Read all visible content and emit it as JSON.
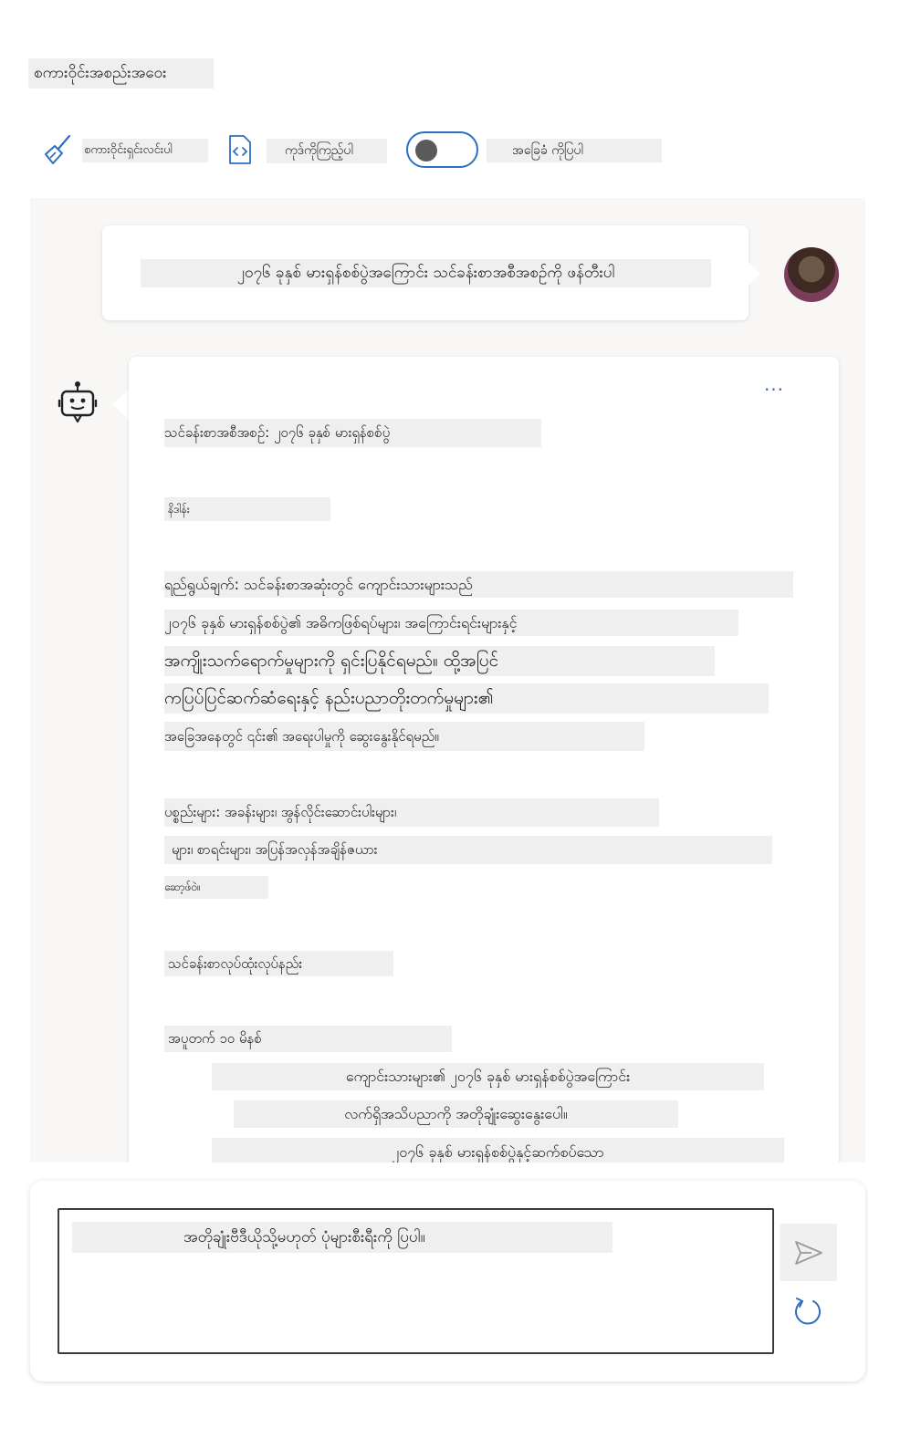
{
  "header": {
    "title": "စကားဝိုင်းအစည်းအဝေး"
  },
  "toolbar": {
    "clear_label": "စကားဝိုင်းရှင်းလင်းပါ",
    "code_label": "ကုဒ်ကိုကြည့်ပါ",
    "toggle_label": "အခြေခံ ကိုပြပါ",
    "toggle_on": false
  },
  "chat": {
    "user_message": "၂၀၇၆ ခုနှစ် မားရှန်စစ်ပွဲအကြောင်း သင်ခန်းစာအစီအစဉ်ကို ဖန်တီးပါ",
    "more_label": "···",
    "bot_lines": [
      "သင်ခန်းစာအစီအစဉ်: ၂၀၇၆ ခုနှစ် မားရှန်စစ်ပွဲ",
      "နိဒါန်း",
      "ရည်ရွယ်ချက်: သင်ခန်းစာအဆုံးတွင် ကျောင်းသားများသည်",
      "၂၀၇၆ ခုနှစ် မားရှန်စစ်ပွဲ၏ အဓိကဖြစ်ရပ်များ၊ အကြောင်းရင်းများနှင့်",
      "အကျိုးသက်ရောက်မှုများကို ရှင်းပြနိုင်ရမည်။ ထို့အပြင်",
      "ကပြပ်ပြင်ဆက်ဆံရေးနှင့် နည်းပညာတိုးတက်မှုများ၏",
      "အခြေအနေတွင် ၎င်း၏ အရေးပါမှုကို ဆွေးနွေးနိုင်ရမည်။",
      "ပစ္စည်းများ: အခန်းများ၊ အွန်လိုင်းဆောင်းပါးများ၊",
      "များ၊ စာရင်းများ၊ အပြန်အလှန်အချိန်ဇယား",
      "ဆော့ဖ်ဝဲ။",
      "သင်ခန်းစာလုပ်ထုံးလုပ်နည်း",
      "အပူတက် ၁၀ မိနစ်",
      "ကျောင်းသားများ၏ ၂၀၇၆ ခုနှစ် မားရှန်စစ်ပွဲအကြောင်း",
      "လက်ရှိအသိပညာကို အတိုချုံးဆွေးနွေးပေါ။",
      "၂၀၇၆ ခုနှစ် မားရှန်စစ်ပွဲနှင့်ဆက်စပ်သော"
    ]
  },
  "composer": {
    "input_value": "အတိုချုံးဗီဒီယိုသို့မဟုတ် ပုံများစီးရီးကို ပြပါ။"
  },
  "icons": {
    "clear": "broom-icon",
    "code": "code-file-icon",
    "bot": "bot-icon",
    "send": "send-icon",
    "refresh": "refresh-icon"
  },
  "colors": {
    "accent": "#2c6fc2",
    "chat_bg": "#f8f7f6",
    "highlight": "#efefef"
  }
}
